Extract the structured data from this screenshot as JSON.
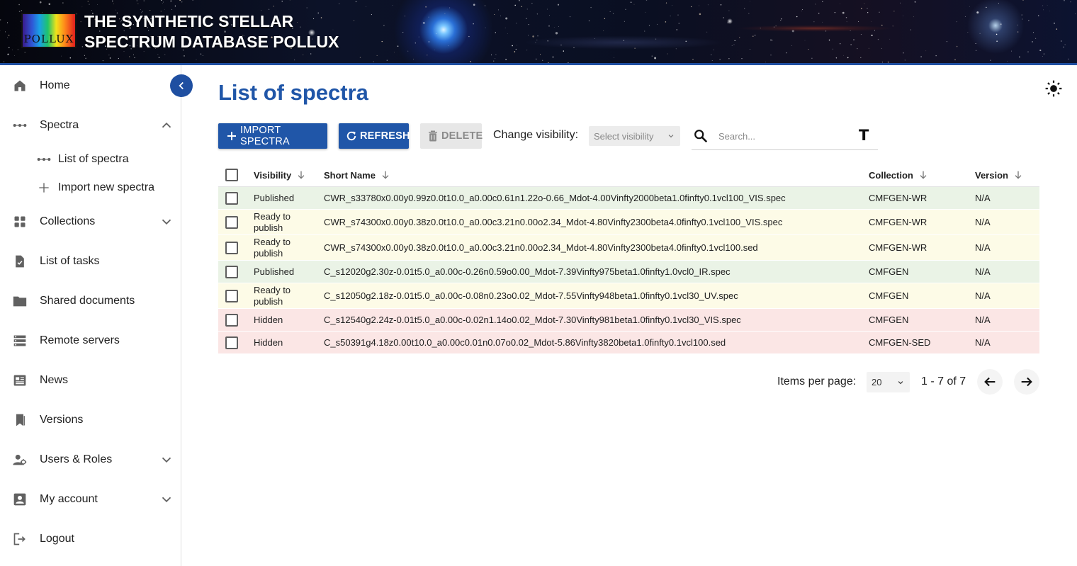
{
  "header": {
    "logo_text": "POLLUX",
    "title_line1": "THE SYNTHETIC STELLAR",
    "title_line2": "SPECTRUM DATABASE POLLUX"
  },
  "sidebar": {
    "items": [
      {
        "label": "Home",
        "icon": "home-icon"
      },
      {
        "label": "Spectra",
        "icon": "spectra-icon",
        "expanded": true
      },
      {
        "label": "List of spectra",
        "icon": "spectra-icon"
      },
      {
        "label": "Import new spectra",
        "icon": "plus-icon"
      },
      {
        "label": "Collections",
        "icon": "collections-icon"
      },
      {
        "label": "List of tasks",
        "icon": "tasks-icon"
      },
      {
        "label": "Shared documents",
        "icon": "folder-icon"
      },
      {
        "label": "Remote servers",
        "icon": "servers-icon"
      },
      {
        "label": "News",
        "icon": "news-icon"
      },
      {
        "label": "Versions",
        "icon": "bookmark-icon"
      },
      {
        "label": "Users & Roles",
        "icon": "users-icon"
      },
      {
        "label": "My account",
        "icon": "account-icon"
      },
      {
        "label": "Logout",
        "icon": "logout-icon"
      }
    ]
  },
  "main": {
    "title": "List of spectra",
    "toolbar": {
      "import_label": "IMPORT SPECTRA",
      "refresh_label": "REFRESH",
      "delete_label": "DELETE",
      "visibility_label": "Change visibility:",
      "visibility_placeholder": "Select visibility",
      "search_placeholder": "Search...",
      "search_extra": "T"
    },
    "table": {
      "columns": [
        "Visibility",
        "Short Name",
        "Collection",
        "Version"
      ],
      "rows": [
        {
          "visibility": "Published",
          "name": "CWR_s33780x0.00y0.99z0.0t10.0_a0.00c0.61n1.22o-0.66_Mdot-4.00Vinfty2000beta1.0finfty0.1vcl100_VIS.spec",
          "collection": "CMFGEN-WR",
          "version": "N/A"
        },
        {
          "visibility": "Ready to publish",
          "name": "CWR_s74300x0.00y0.38z0.0t10.0_a0.00c3.21n0.00o2.34_Mdot-4.80Vinfty2300beta4.0finfty0.1vcl100_VIS.spec",
          "collection": "CMFGEN-WR",
          "version": "N/A"
        },
        {
          "visibility": "Ready to publish",
          "name": "CWR_s74300x0.00y0.38z0.0t10.0_a0.00c3.21n0.00o2.34_Mdot-4.80Vinfty2300beta4.0finfty0.1vcl100.sed",
          "collection": "CMFGEN-WR",
          "version": "N/A"
        },
        {
          "visibility": "Published",
          "name": "C_s12020g2.30z-0.01t5.0_a0.00c-0.26n0.59o0.00_Mdot-7.39Vinfty975beta1.0finfty1.0vcl0_IR.spec",
          "collection": "CMFGEN",
          "version": "N/A"
        },
        {
          "visibility": "Ready to publish",
          "name": "C_s12050g2.18z-0.01t5.0_a0.00c-0.08n0.23o0.02_Mdot-7.55Vinfty948beta1.0finfty0.1vcl30_UV.spec",
          "collection": "CMFGEN",
          "version": "N/A"
        },
        {
          "visibility": "Hidden",
          "name": "C_s12540g2.24z-0.01t5.0_a0.00c-0.02n1.14o0.02_Mdot-7.30Vinfty981beta1.0finfty0.1vcl30_VIS.spec",
          "collection": "CMFGEN",
          "version": "N/A"
        },
        {
          "visibility": "Hidden",
          "name": "C_s50391g4.18z0.00t10.0_a0.00c0.01n0.07o0.02_Mdot-5.86Vinfty3820beta1.0finfty0.1vcl100.sed",
          "collection": "CMFGEN-SED",
          "version": "N/A"
        }
      ]
    },
    "pagination": {
      "items_per_page_label": "Items per page:",
      "items_per_page": "20",
      "range": "1 - 7 of 7"
    }
  },
  "colors": {
    "primary": "#2056a8",
    "published_row": "#eaf3e6",
    "ready_row": "#fdfbe7",
    "hidden_row": "#fbe6e5"
  }
}
